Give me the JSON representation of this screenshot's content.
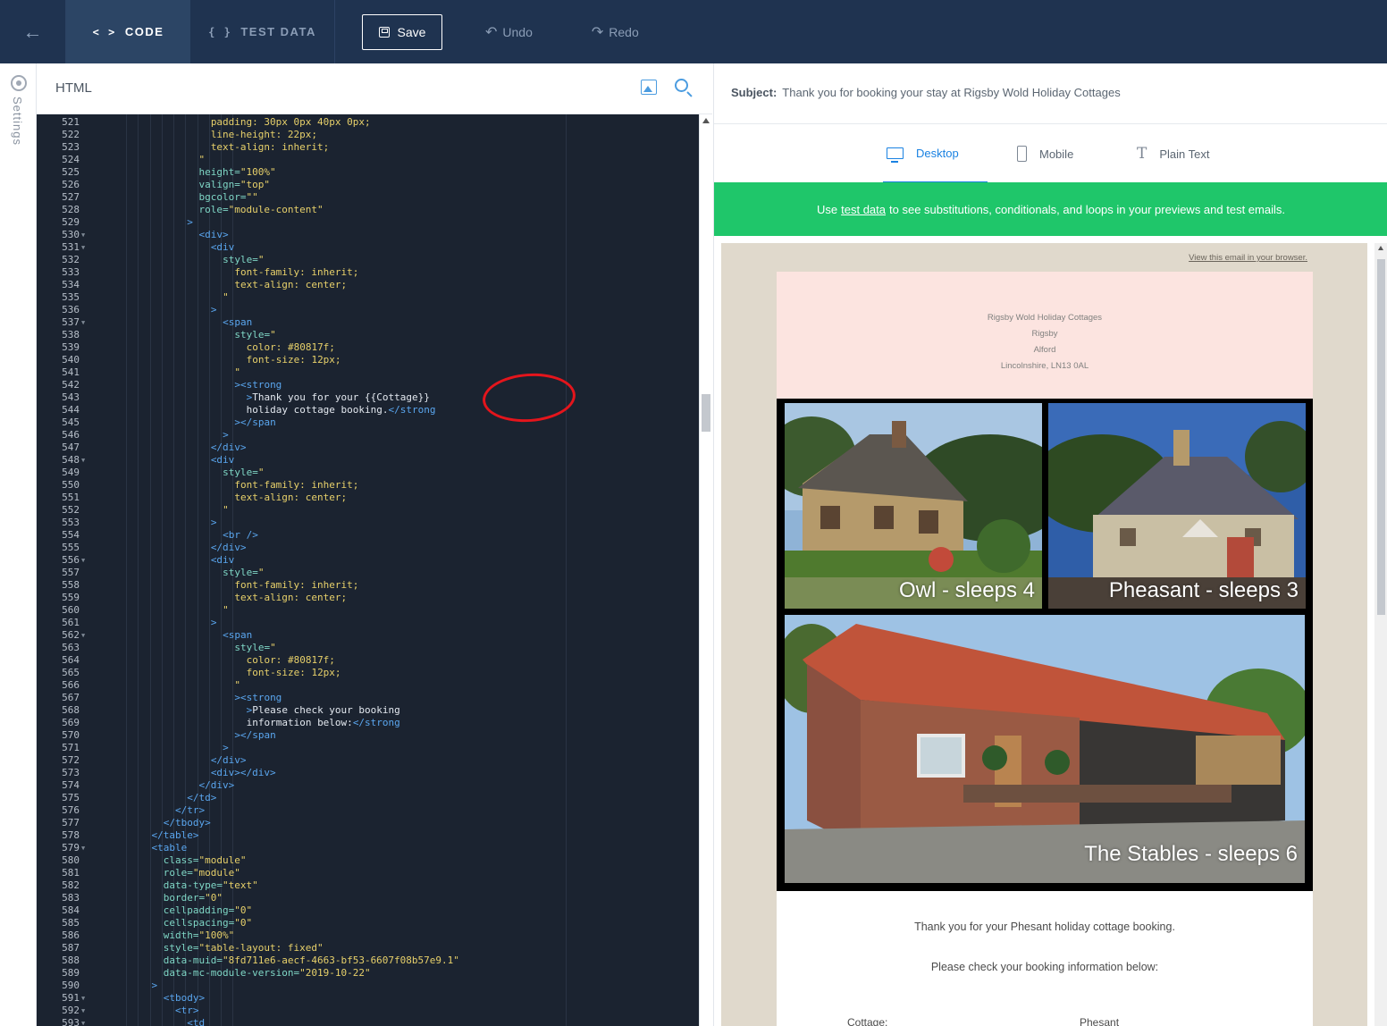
{
  "topbar": {
    "back_icon": "arrow-left-icon",
    "tabs": [
      {
        "symbol": "< >",
        "label": "CODE"
      },
      {
        "symbol": "{ }",
        "label": "TEST DATA"
      }
    ],
    "save_label": "Save",
    "undo_label": "Undo",
    "redo_label": "Redo"
  },
  "sidebar": {
    "settings_label": "Settings"
  },
  "editor": {
    "title": "HTML",
    "lines": [
      {
        "n": "521",
        "fold": false,
        "indent": 14,
        "parts": [
          [
            "css",
            "padding: 30px 0px 40px 0px;"
          ]
        ]
      },
      {
        "n": "522",
        "fold": false,
        "indent": 14,
        "parts": [
          [
            "css",
            "line-height: 22px;"
          ]
        ]
      },
      {
        "n": "523",
        "fold": false,
        "indent": 14,
        "parts": [
          [
            "css",
            "text-align: inherit;"
          ]
        ]
      },
      {
        "n": "524",
        "fold": false,
        "indent": 12,
        "parts": [
          [
            "str",
            "\""
          ]
        ]
      },
      {
        "n": "525",
        "fold": false,
        "indent": 12,
        "parts": [
          [
            "attr",
            "height="
          ],
          [
            "str",
            "\"100%\""
          ]
        ]
      },
      {
        "n": "526",
        "fold": false,
        "indent": 12,
        "parts": [
          [
            "attr",
            "valign="
          ],
          [
            "str",
            "\"top\""
          ]
        ]
      },
      {
        "n": "527",
        "fold": false,
        "indent": 12,
        "parts": [
          [
            "attr",
            "bgcolor="
          ],
          [
            "str",
            "\"\""
          ]
        ]
      },
      {
        "n": "528",
        "fold": false,
        "indent": 12,
        "parts": [
          [
            "attr",
            "role="
          ],
          [
            "str",
            "\"module-content\""
          ]
        ]
      },
      {
        "n": "529",
        "fold": false,
        "indent": 10,
        "parts": [
          [
            "tag",
            ">"
          ]
        ]
      },
      {
        "n": "530",
        "fold": true,
        "indent": 12,
        "parts": [
          [
            "tag",
            "<div>"
          ]
        ]
      },
      {
        "n": "531",
        "fold": true,
        "indent": 14,
        "parts": [
          [
            "tag",
            "<div"
          ]
        ]
      },
      {
        "n": "532",
        "fold": false,
        "indent": 16,
        "parts": [
          [
            "attr",
            "style="
          ],
          [
            "str",
            "\""
          ]
        ]
      },
      {
        "n": "533",
        "fold": false,
        "indent": 18,
        "parts": [
          [
            "css",
            "font-family: inherit;"
          ]
        ]
      },
      {
        "n": "534",
        "fold": false,
        "indent": 18,
        "parts": [
          [
            "css",
            "text-align: center;"
          ]
        ]
      },
      {
        "n": "535",
        "fold": false,
        "indent": 16,
        "parts": [
          [
            "str",
            "\""
          ]
        ]
      },
      {
        "n": "536",
        "fold": false,
        "indent": 14,
        "parts": [
          [
            "tag",
            ">"
          ]
        ]
      },
      {
        "n": "537",
        "fold": true,
        "indent": 16,
        "parts": [
          [
            "tag",
            "<span"
          ]
        ]
      },
      {
        "n": "538",
        "fold": false,
        "indent": 18,
        "parts": [
          [
            "attr",
            "style="
          ],
          [
            "str",
            "\""
          ]
        ]
      },
      {
        "n": "539",
        "fold": false,
        "indent": 20,
        "parts": [
          [
            "css",
            "color: #80817f;"
          ]
        ]
      },
      {
        "n": "540",
        "fold": false,
        "indent": 20,
        "parts": [
          [
            "css",
            "font-size: 12px;"
          ]
        ]
      },
      {
        "n": "541",
        "fold": false,
        "indent": 18,
        "parts": [
          [
            "str",
            "\""
          ]
        ]
      },
      {
        "n": "542",
        "fold": false,
        "indent": 18,
        "parts": [
          [
            "tag",
            "><strong"
          ]
        ]
      },
      {
        "n": "543",
        "fold": false,
        "indent": 20,
        "parts": [
          [
            "tag",
            ">"
          ],
          [
            "plain",
            "Thank you for your {{Cottage}}"
          ]
        ]
      },
      {
        "n": "544",
        "fold": false,
        "indent": 20,
        "parts": [
          [
            "plain",
            "holiday cottage booking."
          ],
          [
            "tag",
            "</strong"
          ]
        ]
      },
      {
        "n": "545",
        "fold": false,
        "indent": 18,
        "parts": [
          [
            "tag",
            "></span"
          ]
        ]
      },
      {
        "n": "546",
        "fold": false,
        "indent": 16,
        "parts": [
          [
            "tag",
            ">"
          ]
        ]
      },
      {
        "n": "547",
        "fold": false,
        "indent": 14,
        "parts": [
          [
            "tag",
            "</div>"
          ]
        ]
      },
      {
        "n": "548",
        "fold": true,
        "indent": 14,
        "parts": [
          [
            "tag",
            "<div"
          ]
        ]
      },
      {
        "n": "549",
        "fold": false,
        "indent": 16,
        "parts": [
          [
            "attr",
            "style="
          ],
          [
            "str",
            "\""
          ]
        ]
      },
      {
        "n": "550",
        "fold": false,
        "indent": 18,
        "parts": [
          [
            "css",
            "font-family: inherit;"
          ]
        ]
      },
      {
        "n": "551",
        "fold": false,
        "indent": 18,
        "parts": [
          [
            "css",
            "text-align: center;"
          ]
        ]
      },
      {
        "n": "552",
        "fold": false,
        "indent": 16,
        "parts": [
          [
            "str",
            "\""
          ]
        ]
      },
      {
        "n": "553",
        "fold": false,
        "indent": 14,
        "parts": [
          [
            "tag",
            ">"
          ]
        ]
      },
      {
        "n": "554",
        "fold": false,
        "indent": 16,
        "parts": [
          [
            "tag",
            "<br />"
          ]
        ]
      },
      {
        "n": "555",
        "fold": false,
        "indent": 14,
        "parts": [
          [
            "tag",
            "</div>"
          ]
        ]
      },
      {
        "n": "556",
        "fold": true,
        "indent": 14,
        "parts": [
          [
            "tag",
            "<div"
          ]
        ]
      },
      {
        "n": "557",
        "fold": false,
        "indent": 16,
        "parts": [
          [
            "attr",
            "style="
          ],
          [
            "str",
            "\""
          ]
        ]
      },
      {
        "n": "558",
        "fold": false,
        "indent": 18,
        "parts": [
          [
            "css",
            "font-family: inherit;"
          ]
        ]
      },
      {
        "n": "559",
        "fold": false,
        "indent": 18,
        "parts": [
          [
            "css",
            "text-align: center;"
          ]
        ]
      },
      {
        "n": "560",
        "fold": false,
        "indent": 16,
        "parts": [
          [
            "str",
            "\""
          ]
        ]
      },
      {
        "n": "561",
        "fold": false,
        "indent": 14,
        "parts": [
          [
            "tag",
            ">"
          ]
        ]
      },
      {
        "n": "562",
        "fold": true,
        "indent": 16,
        "parts": [
          [
            "tag",
            "<span"
          ]
        ]
      },
      {
        "n": "563",
        "fold": false,
        "indent": 18,
        "parts": [
          [
            "attr",
            "style="
          ],
          [
            "str",
            "\""
          ]
        ]
      },
      {
        "n": "564",
        "fold": false,
        "indent": 20,
        "parts": [
          [
            "css",
            "color: #80817f;"
          ]
        ]
      },
      {
        "n": "565",
        "fold": false,
        "indent": 20,
        "parts": [
          [
            "css",
            "font-size: 12px;"
          ]
        ]
      },
      {
        "n": "566",
        "fold": false,
        "indent": 18,
        "parts": [
          [
            "str",
            "\""
          ]
        ]
      },
      {
        "n": "567",
        "fold": false,
        "indent": 18,
        "parts": [
          [
            "tag",
            "><strong"
          ]
        ]
      },
      {
        "n": "568",
        "fold": false,
        "indent": 20,
        "parts": [
          [
            "tag",
            ">"
          ],
          [
            "plain",
            "Please check your booking"
          ]
        ]
      },
      {
        "n": "569",
        "fold": false,
        "indent": 20,
        "parts": [
          [
            "plain",
            "information below:"
          ],
          [
            "tag",
            "</strong"
          ]
        ]
      },
      {
        "n": "570",
        "fold": false,
        "indent": 18,
        "parts": [
          [
            "tag",
            "></span"
          ]
        ]
      },
      {
        "n": "571",
        "fold": false,
        "indent": 16,
        "parts": [
          [
            "tag",
            ">"
          ]
        ]
      },
      {
        "n": "572",
        "fold": false,
        "indent": 14,
        "parts": [
          [
            "tag",
            "</div>"
          ]
        ]
      },
      {
        "n": "573",
        "fold": false,
        "indent": 14,
        "parts": [
          [
            "tag",
            "<div></div>"
          ]
        ]
      },
      {
        "n": "574",
        "fold": false,
        "indent": 12,
        "parts": [
          [
            "tag",
            "</div>"
          ]
        ]
      },
      {
        "n": "575",
        "fold": false,
        "indent": 10,
        "parts": [
          [
            "tag",
            "</td>"
          ]
        ]
      },
      {
        "n": "576",
        "fold": false,
        "indent": 8,
        "parts": [
          [
            "tag",
            "</tr>"
          ]
        ]
      },
      {
        "n": "577",
        "fold": false,
        "indent": 6,
        "parts": [
          [
            "tag",
            "</tbody>"
          ]
        ]
      },
      {
        "n": "578",
        "fold": false,
        "indent": 4,
        "parts": [
          [
            "tag",
            "</table>"
          ]
        ]
      },
      {
        "n": "579",
        "fold": true,
        "indent": 4,
        "parts": [
          [
            "tag",
            "<table"
          ]
        ]
      },
      {
        "n": "580",
        "fold": false,
        "indent": 6,
        "parts": [
          [
            "attr",
            "class="
          ],
          [
            "str",
            "\"module\""
          ]
        ]
      },
      {
        "n": "581",
        "fold": false,
        "indent": 6,
        "parts": [
          [
            "attr",
            "role="
          ],
          [
            "str",
            "\"module\""
          ]
        ]
      },
      {
        "n": "582",
        "fold": false,
        "indent": 6,
        "parts": [
          [
            "attr",
            "data-type="
          ],
          [
            "str",
            "\"text\""
          ]
        ]
      },
      {
        "n": "583",
        "fold": false,
        "indent": 6,
        "parts": [
          [
            "attr",
            "border="
          ],
          [
            "str",
            "\"0\""
          ]
        ]
      },
      {
        "n": "584",
        "fold": false,
        "indent": 6,
        "parts": [
          [
            "attr",
            "cellpadding="
          ],
          [
            "str",
            "\"0\""
          ]
        ]
      },
      {
        "n": "585",
        "fold": false,
        "indent": 6,
        "parts": [
          [
            "attr",
            "cellspacing="
          ],
          [
            "str",
            "\"0\""
          ]
        ]
      },
      {
        "n": "586",
        "fold": false,
        "indent": 6,
        "parts": [
          [
            "attr",
            "width="
          ],
          [
            "str",
            "\"100%\""
          ]
        ]
      },
      {
        "n": "587",
        "fold": false,
        "indent": 6,
        "parts": [
          [
            "attr",
            "style="
          ],
          [
            "str",
            "\"table-layout: fixed\""
          ]
        ]
      },
      {
        "n": "588",
        "fold": false,
        "indent": 6,
        "parts": [
          [
            "attr",
            "data-muid="
          ],
          [
            "str",
            "\"8fd711e6-aecf-4663-bf53-6607f08b57e9.1\""
          ]
        ]
      },
      {
        "n": "589",
        "fold": false,
        "indent": 6,
        "parts": [
          [
            "attr",
            "data-mc-module-version="
          ],
          [
            "str",
            "\"2019-10-22\""
          ]
        ]
      },
      {
        "n": "590",
        "fold": false,
        "indent": 4,
        "parts": [
          [
            "tag",
            ">"
          ]
        ]
      },
      {
        "n": "591",
        "fold": true,
        "indent": 6,
        "parts": [
          [
            "tag",
            "<tbody>"
          ]
        ]
      },
      {
        "n": "592",
        "fold": true,
        "indent": 8,
        "parts": [
          [
            "tag",
            "<tr>"
          ]
        ]
      },
      {
        "n": "593",
        "fold": true,
        "indent": 10,
        "parts": [
          [
            "tag",
            "<td"
          ]
        ]
      }
    ]
  },
  "preview": {
    "subject_label": "Subject:",
    "subject": "Thank you for booking your stay at Rigsby Wold Holiday Cottages",
    "tabs": [
      {
        "label": "Desktop",
        "icon": "desktop-icon"
      },
      {
        "label": "Mobile",
        "icon": "mobile-icon"
      },
      {
        "label": "Plain Text",
        "icon": "text-icon"
      }
    ],
    "banner": {
      "before": "Use",
      "link": "test data",
      "after": "to see substitutions, conditionals, and loops in your previews and test emails."
    },
    "view_in_browser": "View this email in your browser.",
    "address": [
      "Rigsby Wold Holiday Cottages",
      "Rigsby",
      "Alford",
      "Lincolnshire, LN13 0AL"
    ],
    "photos": [
      {
        "caption": "Owl - sleeps 4"
      },
      {
        "caption": "Pheasant - sleeps 3"
      },
      {
        "caption": "The Stables - sleeps 6"
      }
    ],
    "thanks_text": "Thank you for your Phesant holiday cottage booking.",
    "check_text": "Please check your booking information below:",
    "field_label": "Cottage:",
    "field_value": "Phesant"
  },
  "colors": {
    "topbar": "#1f3350",
    "editor_bg": "#1b2330",
    "banner_green": "#1fc66a",
    "accent_blue": "#1a82e2",
    "highlight_red": "#e4151c"
  }
}
